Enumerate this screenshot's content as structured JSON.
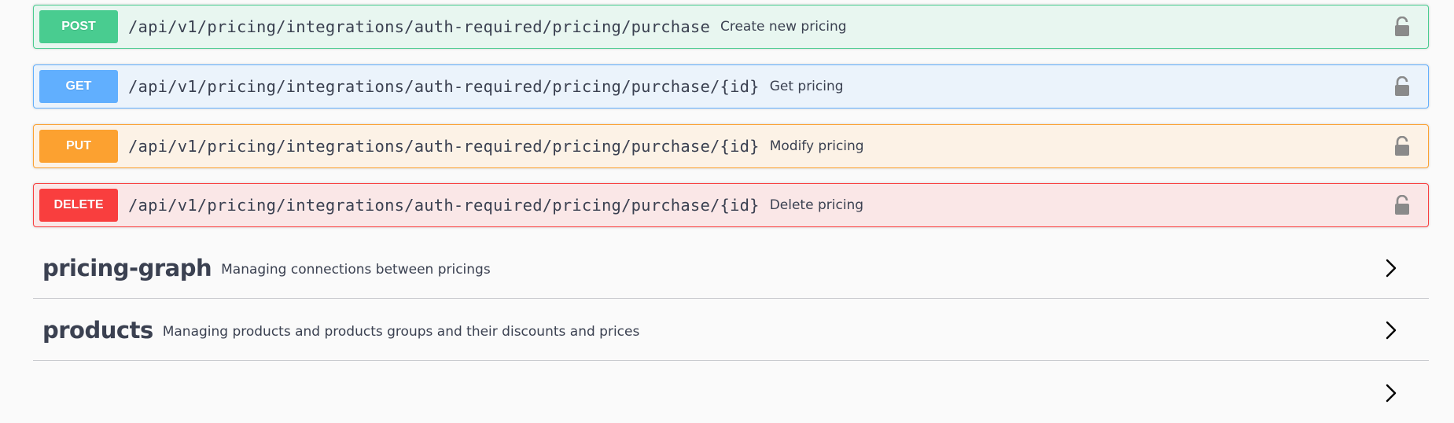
{
  "operations": [
    {
      "method": "POST",
      "path": "/api/v1/pricing/integrations/auth-required/pricing/purchase",
      "summary": "Create new pricing",
      "color": "#49cc90"
    },
    {
      "method": "GET",
      "path": "/api/v1/pricing/integrations/auth-required/pricing/purchase/{id}",
      "summary": "Get pricing",
      "color": "#61affe"
    },
    {
      "method": "PUT",
      "path": "/api/v1/pricing/integrations/auth-required/pricing/purchase/{id}",
      "summary": "Modify pricing",
      "color": "#fca130"
    },
    {
      "method": "DELETE",
      "path": "/api/v1/pricing/integrations/auth-required/pricing/purchase/{id}",
      "summary": "Delete pricing",
      "color": "#f93e3e"
    }
  ],
  "tags": [
    {
      "name": "pricing-graph",
      "description": "Managing connections between pricings"
    },
    {
      "name": "products",
      "description": "Managing products and products groups and their discounts and prices"
    }
  ],
  "icons": {
    "lock": "lock-icon",
    "chevron": "chevron-right-icon"
  }
}
